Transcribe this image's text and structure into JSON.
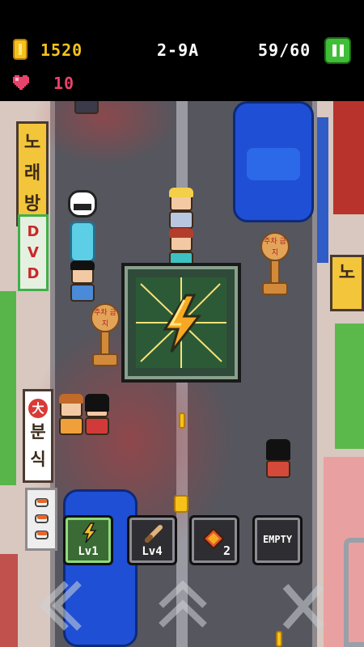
{
  "hud": {
    "coins": "1520",
    "stage": "2-9A",
    "progress": "59/60",
    "lives": "10"
  },
  "icons": {
    "coin": "coin-icon",
    "heart": "heart-icon",
    "pause": "pause-icon"
  },
  "signs": {
    "karaoke": [
      "노",
      "래",
      "방"
    ],
    "dvd": [
      "D",
      "V",
      "D"
    ],
    "bunsik": [
      "분",
      "식"
    ],
    "bunsik_logo": "大",
    "right": "노",
    "no_parking": "주차 금지"
  },
  "powerup": {
    "icon": "lightning-bolt-icon"
  },
  "inventory": {
    "slots": [
      {
        "icon": "lightning-icon",
        "label": "Lv1",
        "active": true
      },
      {
        "icon": "bat-icon",
        "label": "Lv4",
        "active": false
      },
      {
        "icon": "gem-icon",
        "count": "2",
        "active": false
      },
      {
        "label": "EMPTY",
        "active": false
      }
    ]
  },
  "controls": {
    "left": "double-chevron-left-icon",
    "jump": "double-chevron-up-icon",
    "cancel": "x-icon"
  },
  "colors": {
    "road": "#56565e",
    "coin": "#f6c21a",
    "pause_button": "#3fbf38",
    "heart": "#e8436a",
    "car": "#1f4fd4"
  }
}
